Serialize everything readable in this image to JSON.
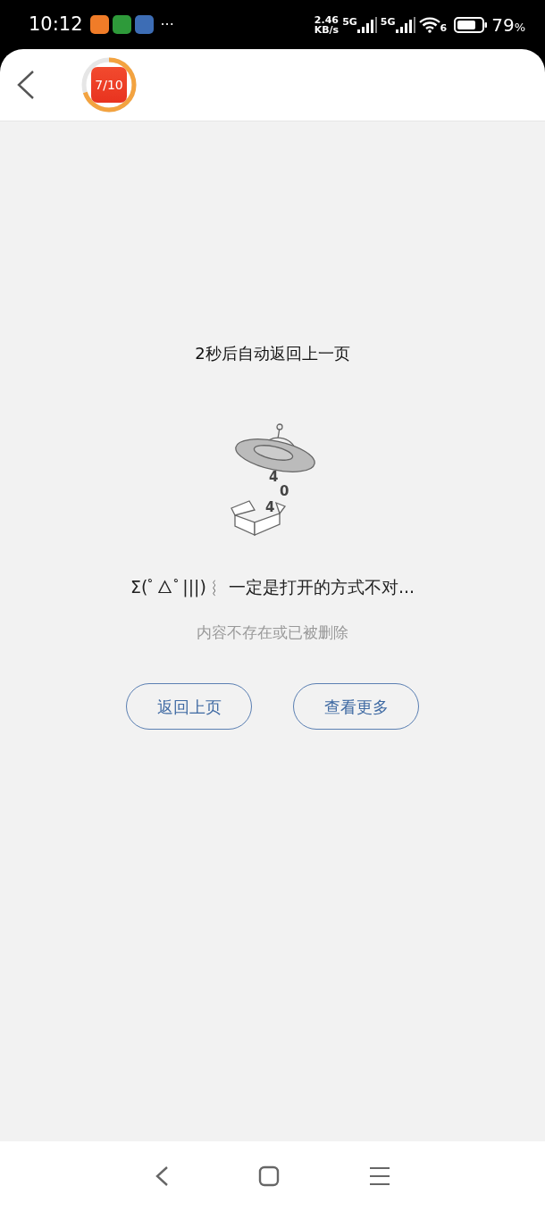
{
  "status_bar": {
    "time": "10:12",
    "more": "···",
    "speed": "2.46",
    "speed_unit": "KB/s",
    "sim": [
      "5G",
      "5G"
    ],
    "wifi_badge": "6",
    "battery": "79",
    "battery_unit": "%"
  },
  "header": {
    "progress": {
      "label": "7/10"
    }
  },
  "countdown": "2秒后自动返回上一页",
  "illustration": {
    "digits": [
      "4",
      "0",
      "4"
    ]
  },
  "message": "Σ(ﾟ△ﾟ|||)︴ 一定是打开的方式不对...",
  "hint": "内容不存在或已被删除",
  "buttons": [
    "返回上页",
    "查看更多"
  ]
}
